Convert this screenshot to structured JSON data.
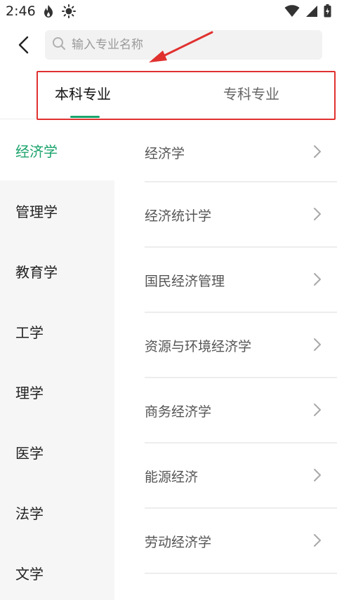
{
  "status_bar": {
    "time": "2:46",
    "icons": [
      "flame-icon",
      "sun-icon",
      "wifi-icon",
      "signal-icon",
      "battery-icon"
    ]
  },
  "header": {
    "back_icon": "chevron-left-icon",
    "search": {
      "placeholder": "输入专业名称",
      "value": "",
      "icon": "search-icon"
    }
  },
  "tabs": [
    {
      "label": "本科专业",
      "active": true
    },
    {
      "label": "专科专业",
      "active": false
    }
  ],
  "sidebar": {
    "items": [
      {
        "label": "经济学",
        "active": true
      },
      {
        "label": "管理学",
        "active": false
      },
      {
        "label": "教育学",
        "active": false
      },
      {
        "label": "工学",
        "active": false
      },
      {
        "label": "理学",
        "active": false
      },
      {
        "label": "医学",
        "active": false
      },
      {
        "label": "法学",
        "active": false
      },
      {
        "label": "文学",
        "active": false
      }
    ]
  },
  "majors": {
    "items": [
      {
        "label": "经济学"
      },
      {
        "label": "经济统计学"
      },
      {
        "label": "国民经济管理"
      },
      {
        "label": "资源与环境经济学"
      },
      {
        "label": "商务经济学"
      },
      {
        "label": "能源经济"
      },
      {
        "label": "劳动经济学"
      }
    ]
  },
  "colors": {
    "accent": "#1aa36b",
    "annotation": "#e0312f",
    "sidebar_bg": "#f6f6f6"
  }
}
